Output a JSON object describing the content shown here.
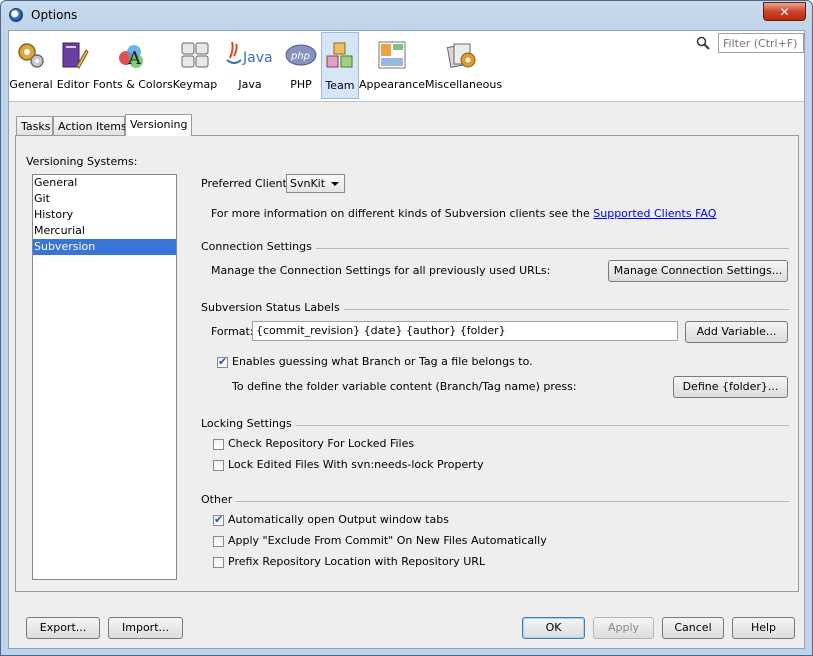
{
  "window": {
    "title": "Options",
    "close_glyph": "✕"
  },
  "categories": [
    {
      "label": "General",
      "icon": "gears-icon"
    },
    {
      "label": "Editor",
      "icon": "editor-icon"
    },
    {
      "label": "Fonts & Colors",
      "icon": "fonts-colors-icon"
    },
    {
      "label": "Keymap",
      "icon": "keymap-icon"
    },
    {
      "label": "Java",
      "icon": "java-icon",
      "icon_text": "Java"
    },
    {
      "label": "PHP",
      "icon": "php-icon",
      "icon_text": "php"
    },
    {
      "label": "Team",
      "icon": "team-icon",
      "selected": true
    },
    {
      "label": "Appearance",
      "icon": "appearance-icon"
    },
    {
      "label": "Miscellaneous",
      "icon": "miscellaneous-icon"
    }
  ],
  "search": {
    "placeholder": "Filter (Ctrl+F)"
  },
  "tabs": [
    {
      "label": "Tasks"
    },
    {
      "label": "Action Items"
    },
    {
      "label": "Versioning",
      "selected": true
    }
  ],
  "versioning": {
    "systems_label": "Versioning Systems:",
    "systems": [
      "General",
      "Git",
      "History",
      "Mercurial",
      "Subversion"
    ],
    "selected_system": "Subversion",
    "preferred_client_label": "Preferred Client:",
    "preferred_client_value": "SvnKit",
    "info_text": "For more information on different kinds of Subversion clients see the",
    "info_link": "Supported Clients FAQ",
    "connection": {
      "title": "Connection Settings",
      "text": "Manage the Connection Settings for all previously used URLs:",
      "button": "Manage Connection Settings..."
    },
    "status_labels": {
      "title": "Subversion Status Labels",
      "format_label": "Format:",
      "format_value": "{commit_revision} {date} {author} {folder}",
      "add_variable_button": "Add Variable...",
      "guess_branch_label": "Enables guessing what Branch or Tag a file belongs to.",
      "guess_branch_checked": true,
      "define_text": "To define the folder variable content (Branch/Tag name) press:",
      "define_button": "Define {folder}..."
    },
    "locking": {
      "title": "Locking Settings",
      "check_locked": {
        "label": "Check Repository For Locked Files",
        "checked": false
      },
      "lock_edited": {
        "label": "Lock Edited Files With svn:needs-lock Property",
        "checked": false
      }
    },
    "other": {
      "title": "Other",
      "auto_output": {
        "label": "Automatically open Output window tabs",
        "checked": true
      },
      "apply_exclude": {
        "label": "Apply \"Exclude From Commit\" On New Files Automatically",
        "checked": false
      },
      "prefix_repo": {
        "label": "Prefix Repository Location with Repository URL",
        "checked": false
      }
    }
  },
  "footer": {
    "export": "Export...",
    "import": "Import...",
    "ok": "OK",
    "apply": "Apply",
    "cancel": "Cancel",
    "help": "Help"
  },
  "colors": {
    "accent": "#3875d7",
    "link": "#0000ee",
    "selected_category_bg": "#d7e6f7",
    "close_button": "#c8462c"
  }
}
